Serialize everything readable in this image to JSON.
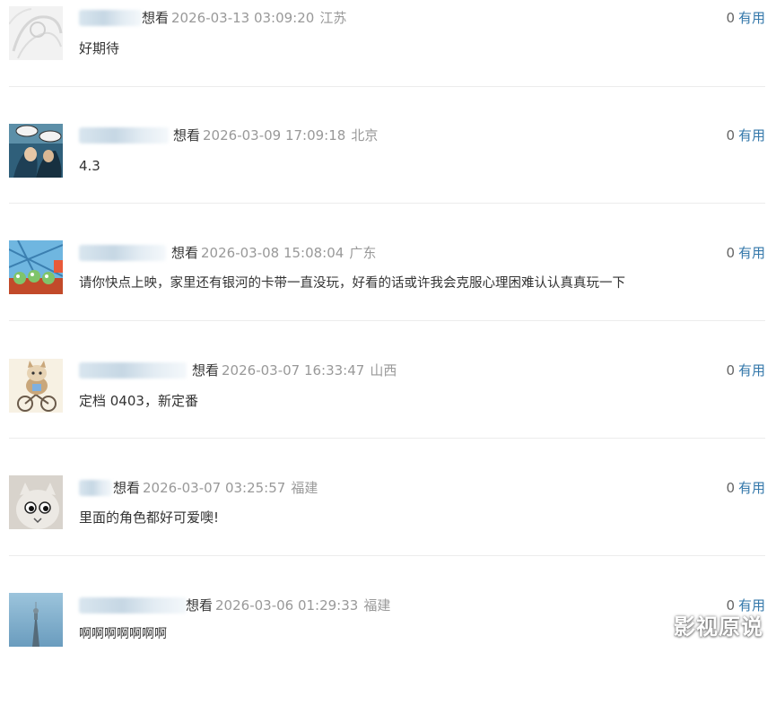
{
  "comments": [
    {
      "status": "想看",
      "time": "2026-03-13 03:09:20",
      "location": "江苏",
      "text": "好期待",
      "votes": "0",
      "vote_label": "有用"
    },
    {
      "status": "想看",
      "time": "2026-03-09 17:09:18",
      "location": "北京",
      "text": "4.3",
      "votes": "0",
      "vote_label": "有用"
    },
    {
      "status": "想看",
      "time": "2026-03-08 15:08:04",
      "location": "广东",
      "text": "请你快点上映，家里还有银河的卡带一直没玩，好看的话或许我会克服心理困难认认真真玩一下",
      "votes": "0",
      "vote_label": "有用"
    },
    {
      "status": "想看",
      "time": "2026-03-07 16:33:47",
      "location": "山西",
      "text": "定档 0403，新定番",
      "votes": "0",
      "vote_label": "有用"
    },
    {
      "status": "想看",
      "time": "2026-03-07 03:25:57",
      "location": "福建",
      "text": "里面的角色都好可爱噢!",
      "votes": "0",
      "vote_label": "有用"
    },
    {
      "status": "想看",
      "time": "2026-03-06 01:29:33",
      "location": "福建",
      "text": "啊啊啊啊啊啊啊",
      "votes": "0",
      "vote_label": "有用"
    }
  ],
  "watermark": "影视原说"
}
